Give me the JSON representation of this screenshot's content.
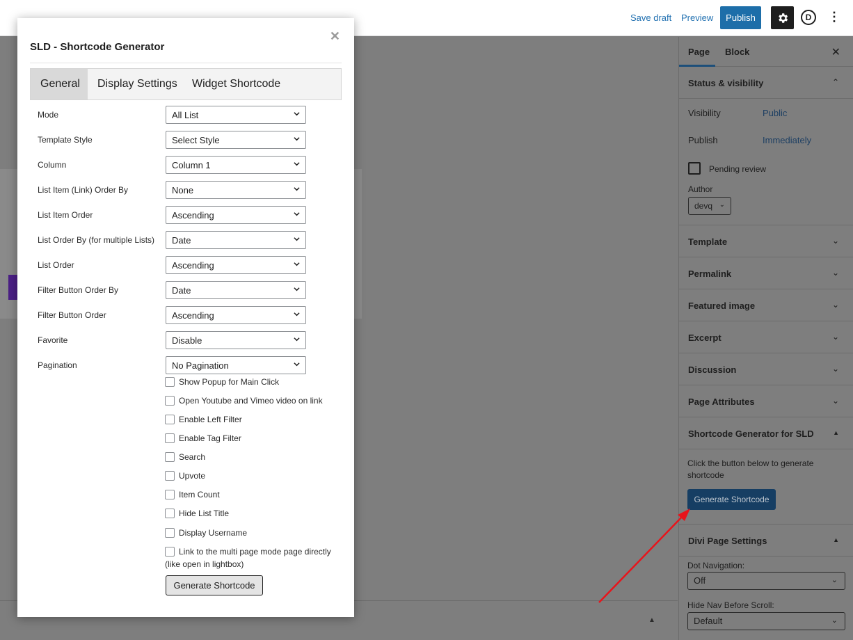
{
  "topbar": {
    "save_draft": "Save draft",
    "preview": "Preview",
    "publish": "Publish",
    "divi_letter": "D"
  },
  "sidebar": {
    "tabs": [
      "Page",
      "Block"
    ],
    "status_panel": {
      "title": "Status & visibility",
      "visibility_label": "Visibility",
      "visibility_value": "Public",
      "publish_label": "Publish",
      "publish_value": "Immediately",
      "pending_review": "Pending review",
      "author_label": "Author",
      "author_value": "devq"
    },
    "panels": [
      "Template",
      "Permalink",
      "Featured image",
      "Excerpt",
      "Discussion",
      "Page Attributes"
    ],
    "shortcode_panel": {
      "title": "Shortcode Generator for SLD",
      "text": "Click the button below to generate shortcode",
      "button": "Generate Shortcode"
    },
    "divi_panel": {
      "title": "Divi Page Settings",
      "dot_nav_label": "Dot Navigation:",
      "dot_nav_value": "Off",
      "hide_nav_label": "Hide Nav Before Scroll:",
      "hide_nav_value": "Default"
    }
  },
  "modal": {
    "title": "SLD - Shortcode Generator",
    "tabs": [
      "General",
      "Display Settings",
      "Widget Shortcode"
    ],
    "fields": [
      {
        "label": "Mode",
        "value": "All List"
      },
      {
        "label": "Template Style",
        "value": "Select Style"
      },
      {
        "label": "Column",
        "value": "Column 1"
      },
      {
        "label": "List Item (Link) Order By",
        "value": "None"
      },
      {
        "label": "List Item Order",
        "value": "Ascending"
      },
      {
        "label": "List Order By (for multiple Lists)",
        "value": "Date"
      },
      {
        "label": "List Order",
        "value": "Ascending"
      },
      {
        "label": "Filter Button Order By",
        "value": "Date"
      },
      {
        "label": "Filter Button Order",
        "value": "Ascending"
      },
      {
        "label": "Favorite",
        "value": "Disable"
      },
      {
        "label": "Pagination",
        "value": "No Pagination"
      }
    ],
    "checkboxes": [
      "Show Popup for Main Click",
      "Open Youtube and Vimeo video on link",
      "Enable Left Filter",
      "Enable Tag Filter",
      "Search",
      "Upvote",
      "Item Count",
      "Hide List Title",
      "Display Username",
      "Link to the multi page mode page directly (like open in lightbox)"
    ],
    "generate_button": "Generate Shortcode"
  },
  "colors": {
    "accent": "#1d6ea9",
    "annotation_arrow": "#e8141b"
  }
}
